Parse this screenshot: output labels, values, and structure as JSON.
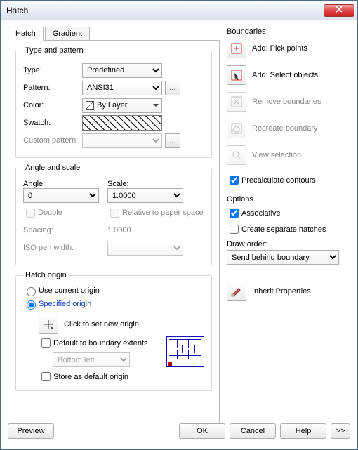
{
  "window": {
    "title": "Hatch"
  },
  "tabs": {
    "hatch": "Hatch",
    "gradient": "Gradient"
  },
  "typepattern": {
    "legend": "Type and pattern",
    "type_label": "Type:",
    "type_value": "Predefined",
    "pattern_label": "Pattern:",
    "pattern_value": "ANSI31",
    "color_label": "Color:",
    "color_value": "By Layer",
    "swatch_label": "Swatch:",
    "custom_label": "Custom pattern:",
    "ellipsis": "..."
  },
  "anglescale": {
    "legend": "Angle and scale",
    "angle_label": "Angle:",
    "angle_value": "0",
    "scale_label": "Scale:",
    "scale_value": "1.0000",
    "double_label": "Double",
    "relative_label": "Relative to paper space",
    "spacing_label": "Spacing:",
    "spacing_value": "1.0000",
    "iso_label": "ISO pen width:"
  },
  "origin": {
    "legend": "Hatch origin",
    "use_current": "Use current origin",
    "specified": "Specified origin",
    "click_set": "Click to set new origin",
    "default_ext": "Default to boundary extents",
    "position": "Bottom left",
    "store_default": "Store as default origin"
  },
  "boundaries": {
    "legend": "Boundaries",
    "pick": "Add: Pick points",
    "select": "Add: Select objects",
    "remove": "Remove boundaries",
    "recreate": "Recreate boundary",
    "view": "View selection",
    "precalc": "Precalculate contours"
  },
  "options": {
    "legend": "Options",
    "assoc": "Associative",
    "separate": "Create separate hatches",
    "draworder_label": "Draw order:",
    "draworder_value": "Send behind boundary"
  },
  "inherit": "Inherit Properties",
  "buttons": {
    "preview": "Preview",
    "ok": "OK",
    "cancel": "Cancel",
    "help": "Help",
    "more": ">>"
  }
}
